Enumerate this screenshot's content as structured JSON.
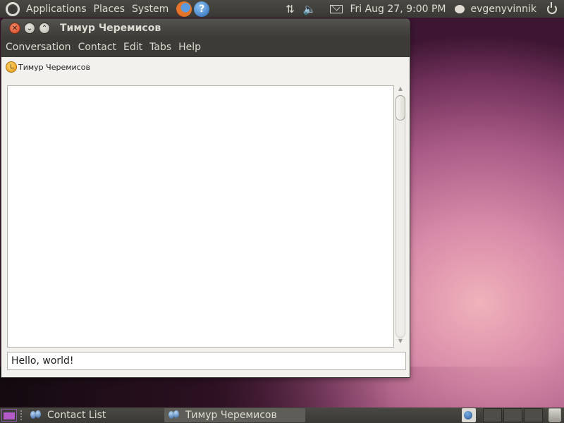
{
  "top_panel": {
    "menus": [
      "Applications",
      "Places",
      "System"
    ],
    "datetime": "Fri Aug 27,  9:00 PM",
    "username": "evgenyvinnik"
  },
  "window": {
    "title": "Тимур Черемисов",
    "menu": [
      "Conversation",
      "Contact",
      "Edit",
      "Tabs",
      "Help"
    ],
    "tab_label": "Тимур Черемисов",
    "message_input_value": "Hello, world!"
  },
  "taskbar": {
    "tasks": [
      {
        "label": "Contact List",
        "active": false
      },
      {
        "label": "Тимур Черемисов",
        "active": true
      }
    ]
  },
  "colors": {
    "panel": "#3c3b37",
    "close_button": "#d24b26",
    "accent_purple": "#b35ac8"
  },
  "icons": {
    "top_panel": [
      "ubuntu-logo-icon",
      "firefox-icon",
      "help-icon",
      "network-icon",
      "volume-icon",
      "mail-icon",
      "status-icon",
      "power-icon"
    ],
    "tab": "away-status-icon"
  }
}
